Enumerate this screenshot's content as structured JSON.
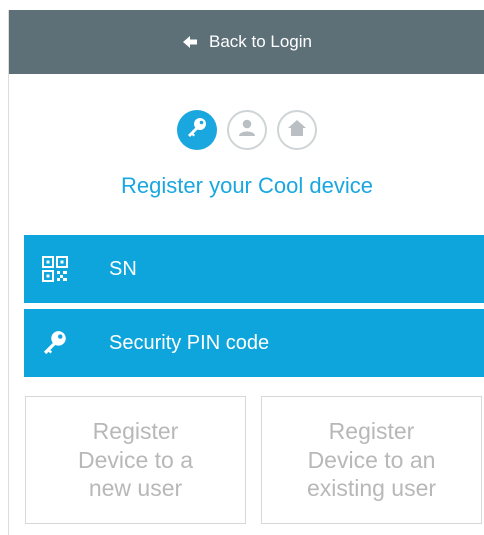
{
  "header": {
    "back_label": "Back to Login",
    "back_icon": "arrow-left-icon"
  },
  "steps": [
    {
      "icon": "key-icon",
      "state": "active"
    },
    {
      "icon": "user-icon",
      "state": "inactive"
    },
    {
      "icon": "home-icon",
      "state": "inactive"
    }
  ],
  "title": "Register your Cool device",
  "fields": [
    {
      "icon": "qr-code-icon",
      "label": "SN"
    },
    {
      "icon": "key-icon",
      "label": "Security PIN code"
    }
  ],
  "buttons": {
    "new_user": "Register\nDevice to a\nnew user",
    "existing_user": "Register\nDevice to an\nexisting user"
  },
  "colors": {
    "accent": "#0ea5dd",
    "header": "#5d7078",
    "disabled_text": "#b8b8b8"
  }
}
